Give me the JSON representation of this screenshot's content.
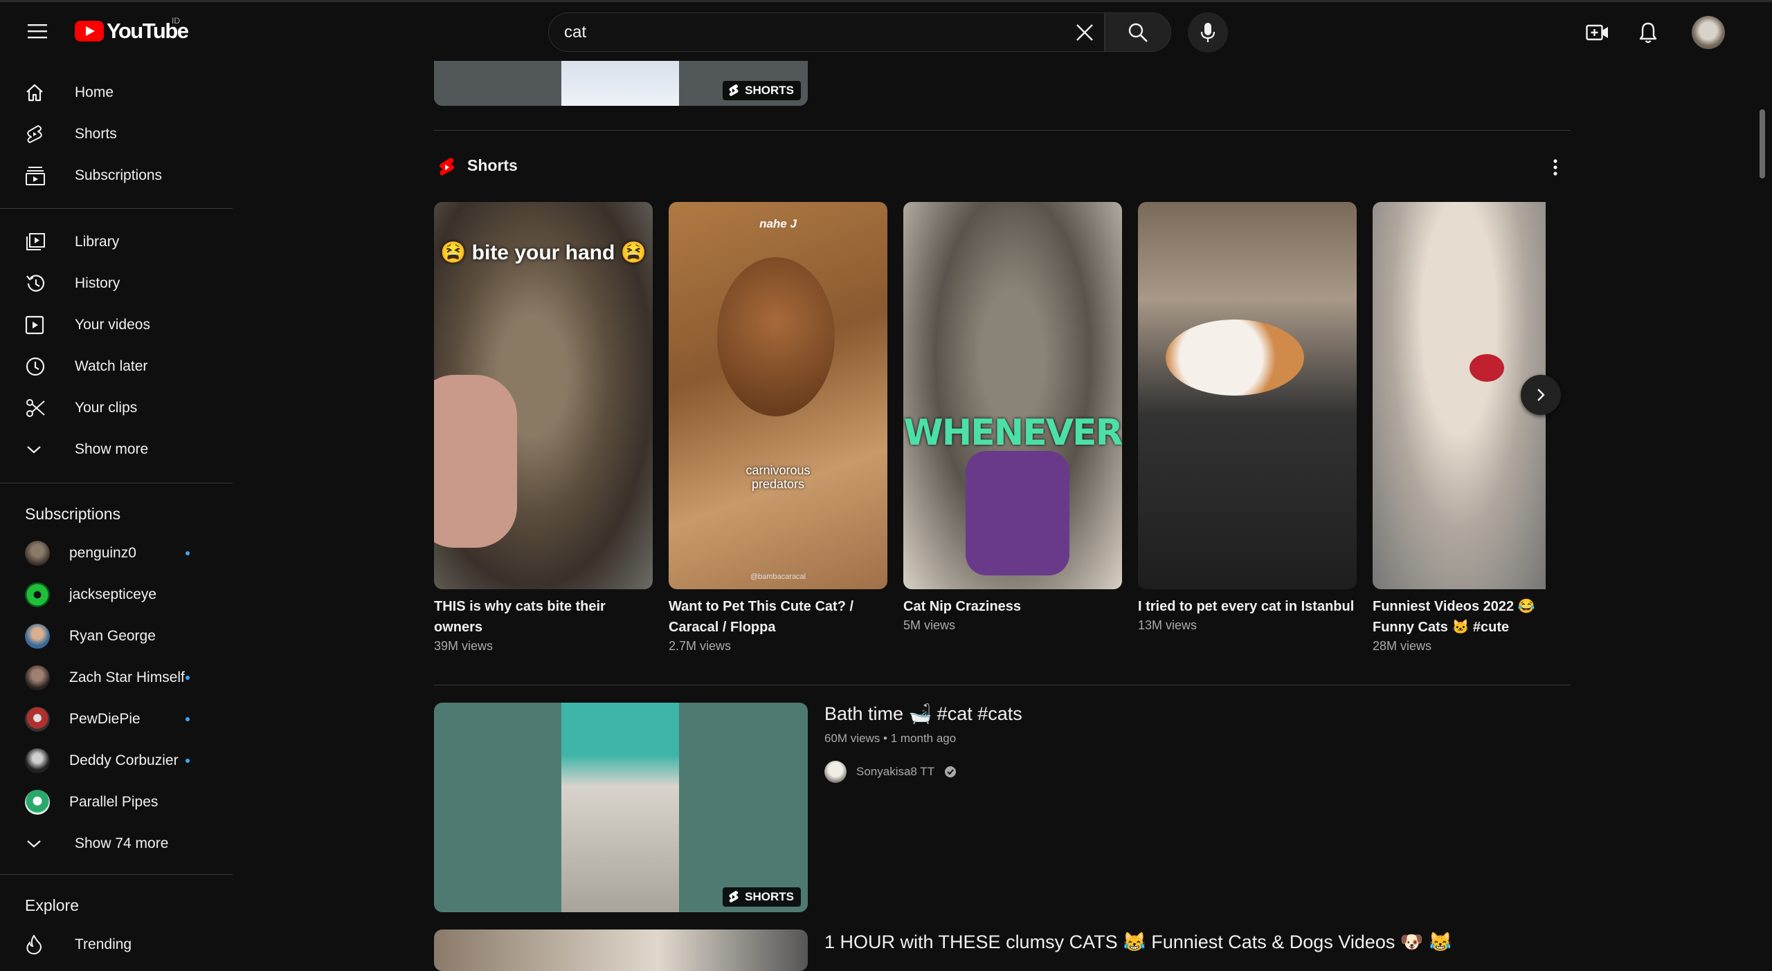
{
  "header": {
    "logo_text": "YouTube",
    "country_code": "ID",
    "search_value": "cat"
  },
  "sidebar": {
    "main": [
      {
        "label": "Home",
        "icon": "home-icon"
      },
      {
        "label": "Shorts",
        "icon": "shorts-icon"
      },
      {
        "label": "Subscriptions",
        "icon": "subscriptions-icon"
      }
    ],
    "library": [
      {
        "label": "Library",
        "icon": "library-icon"
      },
      {
        "label": "History",
        "icon": "history-icon"
      },
      {
        "label": "Your videos",
        "icon": "your-videos-icon"
      },
      {
        "label": "Watch later",
        "icon": "watch-later-icon"
      },
      {
        "label": "Your clips",
        "icon": "scissors-icon"
      },
      {
        "label": "Show more",
        "icon": "chevron-down-icon"
      }
    ],
    "subscriptions_title": "Subscriptions",
    "subscriptions": [
      {
        "name": "penguinz0",
        "new": true,
        "color": "#5a4a3a"
      },
      {
        "name": "jacksepticeye",
        "new": false,
        "color": "#1fbf3a"
      },
      {
        "name": "Ryan George",
        "new": false,
        "color": "#3a6a9a"
      },
      {
        "name": "Zach Star Himself",
        "new": true,
        "color": "#4a3a30"
      },
      {
        "name": "PewDiePie",
        "new": true,
        "color": "#b03030"
      },
      {
        "name": "Deddy Corbuzier",
        "new": true,
        "color": "#2a2a2a"
      },
      {
        "name": "Parallel Pipes",
        "new": false,
        "color": "#2aa86a"
      }
    ],
    "show_more_subs": "Show 74 more",
    "explore_title": "Explore",
    "trending": "Trending"
  },
  "main": {
    "shorts_badge": "SHORTS",
    "shelf_title": "Shorts",
    "shorts": [
      {
        "title": "THIS is why cats bite their owners",
        "views": "39M views",
        "overlay": "😫 bite your hand 😫"
      },
      {
        "title": "Want to Pet This Cute Cat? / Caracal / Floppa",
        "views": "2.7M views",
        "overlay": "carnivorous predators",
        "overlay_top": "nahe J",
        "watermark": "@bambacaracal"
      },
      {
        "title": "Cat Nip Craziness",
        "views": "5M views",
        "overlay": "WHENEVER"
      },
      {
        "title": "I tried to pet every cat in Istanbul",
        "views": "13M views"
      },
      {
        "title": "Funniest Videos 2022 😂 Funny Cats 🐱 #cute #cat...",
        "views": "28M views"
      }
    ],
    "video": {
      "title": "Bath time 🛁 #cat #cats",
      "meta": "60M views • 1 month ago",
      "channel": "Sonyakisa8 TT"
    },
    "next_video_title": "1 HOUR with THESE clumsy CATS 😹 Funniest Cats & Dogs Videos 🐶 😹"
  }
}
